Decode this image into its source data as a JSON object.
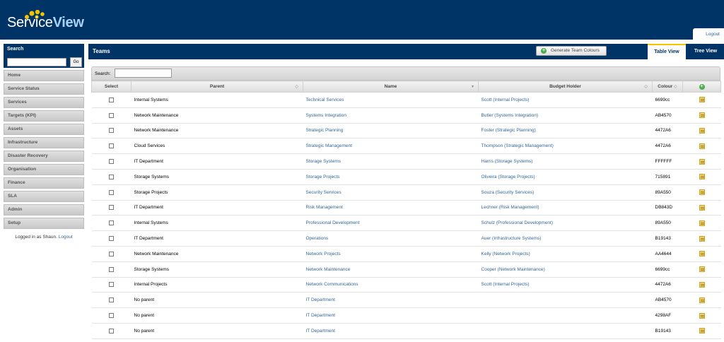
{
  "app": {
    "logo_part1": "Service",
    "logo_part2": "View",
    "logout_label": "Logout"
  },
  "sidebar": {
    "search_title": "Search",
    "go_label": "Go",
    "items": [
      "Home",
      "Service Status",
      "Services",
      "Targets (KPI)",
      "Assets",
      "Infrastructure",
      "Disaster Recovery",
      "Organisation",
      "Finance",
      "SLA",
      "Admin",
      "Setup"
    ],
    "logged_in_text": "Logged in as Shaun.",
    "logout_link": "Logout"
  },
  "panel": {
    "title": "Teams",
    "generate_label": "Generate Team Colours",
    "tab_table": "Table View",
    "tab_tree": "Tree View"
  },
  "table": {
    "search_label": "Search:",
    "headers": {
      "select": "Select",
      "parent": "Parent",
      "name": "Name",
      "budget": "Budget Holder",
      "colour": "Colour"
    },
    "rows": [
      {
        "parent": "Internal Systems",
        "name": "Technical Services",
        "budget": "Scott (Internal Projects)",
        "colour": "6699cc"
      },
      {
        "parent": "Network Maintenance",
        "name": "Systems Integration",
        "budget": "Butler (Systems Integration)",
        "colour": "AB4570"
      },
      {
        "parent": "Network Maintenance",
        "name": "Strategic Planning",
        "budget": "Foster (Strategic Planning)",
        "colour": "4472A6"
      },
      {
        "parent": "Cloud Services",
        "name": "Strategic Management",
        "budget": "Thompson (Strategic Management)",
        "colour": "4472A6"
      },
      {
        "parent": "IT Department",
        "name": "Storage Systems",
        "budget": "Harris (Storage Systems)",
        "colour": "FFFFFF"
      },
      {
        "parent": "Storage Systems",
        "name": "Storage Projects",
        "budget": "Oliveira (Storage Projects)",
        "colour": "715891"
      },
      {
        "parent": "Storage Projects",
        "name": "Security Services",
        "budget": "Souza (Security Services)",
        "colour": "89A550"
      },
      {
        "parent": "IT Department",
        "name": "Risk Management",
        "budget": "Lechner (Risk Management)",
        "colour": "DB843D"
      },
      {
        "parent": "Internal Systems",
        "name": "Professional Development",
        "budget": "Schulz (Professional Development)",
        "colour": "89A550"
      },
      {
        "parent": "IT Department",
        "name": "Operations",
        "budget": "Auer (Infrastructure Systems)",
        "colour": "B19143"
      },
      {
        "parent": "Network Maintenance",
        "name": "Network Projects",
        "budget": "Kelly (Network Projects)",
        "colour": "AA4644"
      },
      {
        "parent": "Storage Systems",
        "name": "Network Maintenance",
        "budget": "Cooper (Network Maintenance)",
        "colour": "6699cc"
      },
      {
        "parent": "Internal Projects",
        "name": "Network Communications",
        "budget": "Scott (Internal Projects)",
        "colour": "4472A6"
      },
      {
        "parent": "No parent",
        "name": "IT Department",
        "budget": "",
        "colour": "AB4570"
      },
      {
        "parent": "No parent",
        "name": "IT Department",
        "budget": "",
        "colour": "4298AF"
      },
      {
        "parent": "No parent",
        "name": "IT Department",
        "budget": "",
        "colour": "B19143"
      }
    ]
  }
}
